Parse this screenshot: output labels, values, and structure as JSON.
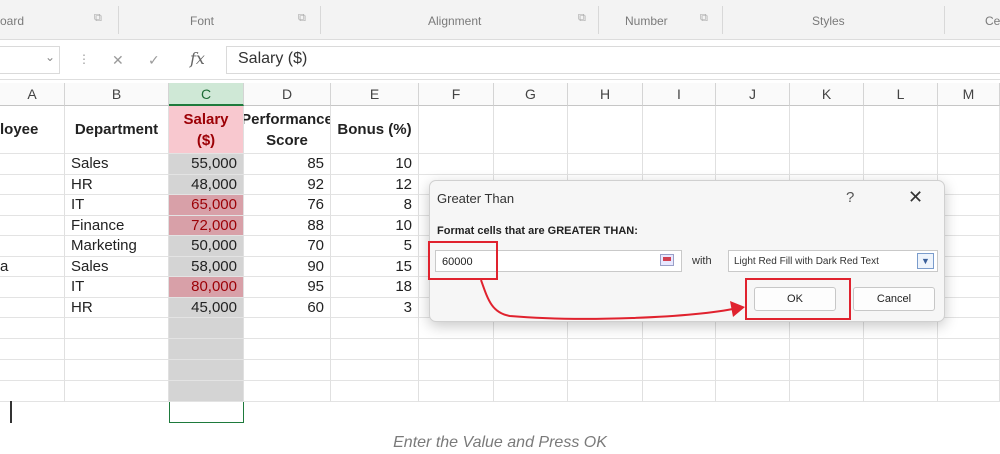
{
  "ribbon": {
    "groups": [
      "oard",
      "Font",
      "Alignment",
      "Number",
      "Styles",
      "Ce"
    ]
  },
  "formula_bar": {
    "name_box_chevron": "⌄",
    "cancel_glyph": "✕",
    "enter_glyph": "✓",
    "fx_label": "fx",
    "content": "Salary ($)"
  },
  "sheet": {
    "columns": [
      "A",
      "B",
      "C",
      "D",
      "E",
      "F",
      "G",
      "H",
      "I",
      "J",
      "K",
      "L",
      "M"
    ],
    "headers": [
      "loyee",
      "Department",
      "Salary ($)",
      "Performance Score",
      "Bonus (%)"
    ],
    "rows": [
      {
        "a": "",
        "department": "Sales",
        "salary": "55,000",
        "score": "85",
        "bonus": "10",
        "highlighted": false
      },
      {
        "a": "",
        "department": "HR",
        "salary": "48,000",
        "score": "92",
        "bonus": "12",
        "highlighted": false
      },
      {
        "a": "",
        "department": "IT",
        "salary": "65,000",
        "score": "76",
        "bonus": "8",
        "highlighted": true
      },
      {
        "a": "",
        "department": "Finance",
        "salary": "72,000",
        "score": "88",
        "bonus": "10",
        "highlighted": true
      },
      {
        "a": "",
        "department": "Marketing",
        "salary": "50,000",
        "score": "70",
        "bonus": "5",
        "highlighted": false
      },
      {
        "a": "a",
        "department": "Sales",
        "salary": "58,000",
        "score": "90",
        "bonus": "15",
        "highlighted": false
      },
      {
        "a": "",
        "department": "IT",
        "salary": "80,000",
        "score": "95",
        "bonus": "18",
        "highlighted": true
      },
      {
        "a": "",
        "department": "HR",
        "salary": "45,000",
        "score": "60",
        "bonus": "3",
        "highlighted": false
      }
    ]
  },
  "dialog": {
    "title": "Greater Than",
    "help": "?",
    "close": "✕",
    "prompt": "Format cells that are GREATER THAN:",
    "value": "60000",
    "with_label": "with",
    "format_option": "Light Red Fill with Dark Red Text",
    "ok_label": "OK",
    "cancel_label": "Cancel"
  },
  "caption": "Enter the Value and Press OK",
  "colors": {
    "highlight_fill": "#f8c8cf",
    "highlight_text": "#9c0006",
    "selection_green": "#1e7a3c",
    "annotation_red": "#e0222e"
  }
}
